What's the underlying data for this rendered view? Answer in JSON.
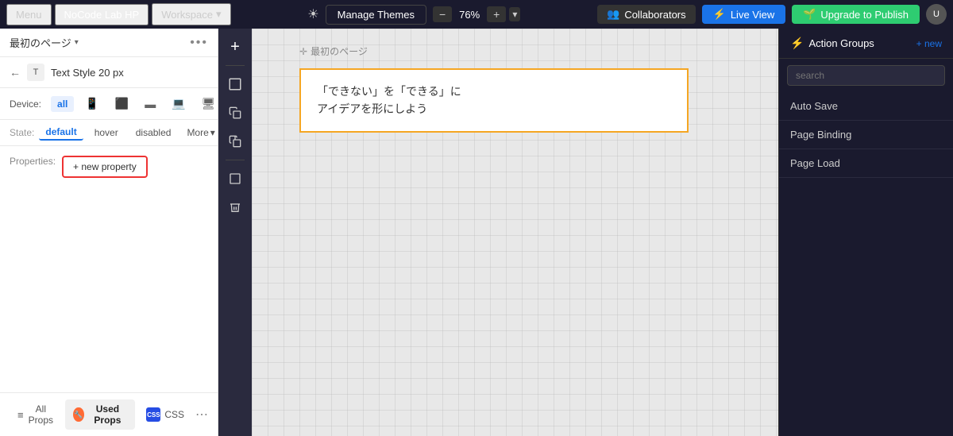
{
  "topNav": {
    "menu": "Menu",
    "brand": "NoCode Lab HP",
    "workspace": "Workspace",
    "manageThemes": "Manage Themes",
    "zoomValue": "76%",
    "collaborators": "Collaborators",
    "liveView": "Live View",
    "upgradeToPublish": "Upgrade to Publish"
  },
  "leftPanel": {
    "pageTitle": "最初のページ",
    "elementTitle": "Text Style 20 px",
    "deviceLabel": "Device:",
    "deviceAll": "all",
    "stateLabel": "State:",
    "stateDefault": "default",
    "stateHover": "hover",
    "stateDisabled": "disabled",
    "stateMore": "More",
    "propertiesLabel": "Properties:",
    "newPropertyBtn": "+ new property",
    "footerAllProps": "All Props",
    "footerUsedProps": "Used Props",
    "footerCSS": "CSS"
  },
  "canvas": {
    "pageLabel": "最初のページ",
    "textLine1": "「できない」を「できる」に",
    "textLine2": "アイデアを形にしよう"
  },
  "rightPanel": {
    "title": "Action Groups",
    "newLabel": "+ new",
    "searchPlaceholder": "search",
    "items": [
      {
        "label": "Auto Save"
      },
      {
        "label": "Page Binding"
      },
      {
        "label": "Page Load"
      }
    ]
  }
}
